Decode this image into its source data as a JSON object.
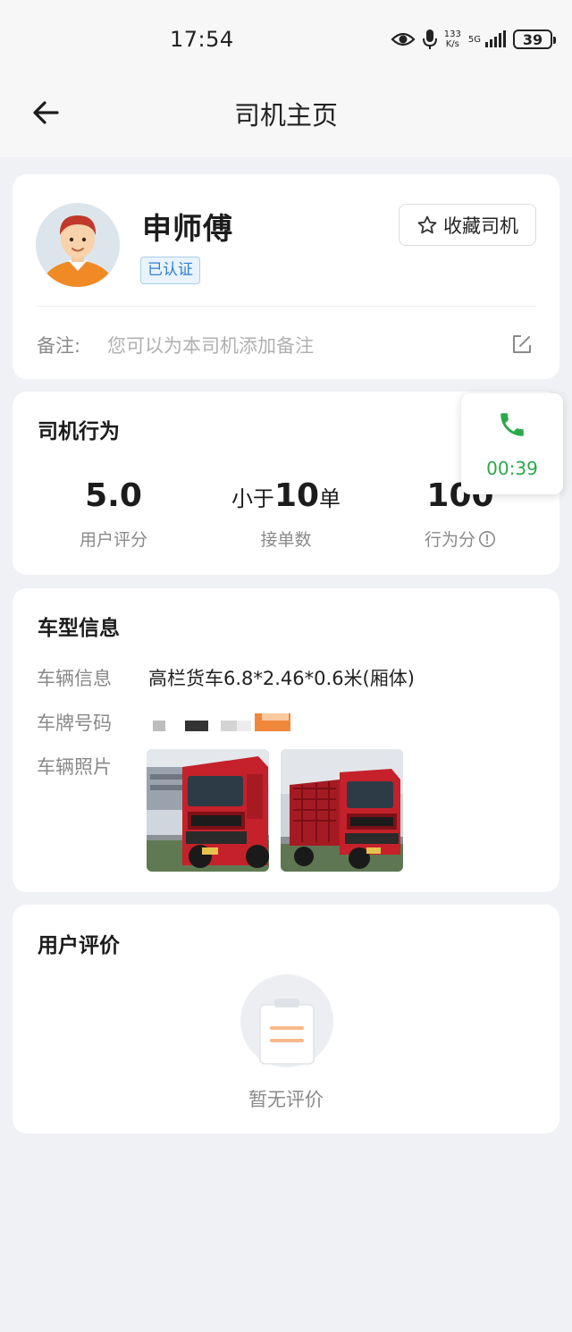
{
  "status_bar": {
    "time": "17:54",
    "net_speed_value": "133",
    "net_speed_unit": "K/s",
    "signal_label": "5G",
    "battery": "39"
  },
  "nav": {
    "title": "司机主页"
  },
  "profile": {
    "name": "申师傅",
    "verified_badge": "已认证",
    "favorite_button": "收藏司机",
    "remark_label": "备注:",
    "remark_placeholder": "您可以为本司机添加备注"
  },
  "behavior": {
    "title": "司机行为",
    "stats": [
      {
        "value": "5.0",
        "label": "用户评分"
      },
      {
        "prefix": "小于",
        "value": "10",
        "suffix": "单",
        "label": "接单数"
      },
      {
        "value": "100",
        "label": "行为分"
      }
    ]
  },
  "call": {
    "timer": "00:39"
  },
  "vehicle": {
    "title": "车型信息",
    "info_label": "车辆信息",
    "info_value": "高栏货车6.8*2.46*0.6米(厢体)",
    "plate_label": "车牌号码",
    "photos_label": "车辆照片"
  },
  "reviews": {
    "title": "用户评价",
    "empty_text": "暂无评价"
  },
  "colors": {
    "accent_green": "#2aa94a",
    "badge_blue": "#2f7fd1",
    "truck_red": "#c4212b"
  }
}
